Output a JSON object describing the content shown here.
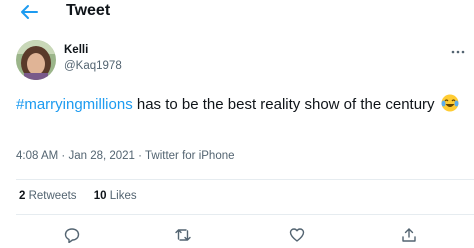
{
  "header": {
    "title": "Tweet"
  },
  "author": {
    "name": "Kelli",
    "handle": "@Kaq1978"
  },
  "tweet": {
    "hashtag": "#marryingmillions",
    "text": " has to be the best reality show of the century",
    "emoji": "face-with-tears-of-joy"
  },
  "meta": {
    "time": "4:08 AM",
    "separator": "·",
    "date": "Jan 28, 2021",
    "source": "Twitter for iPhone"
  },
  "stats": {
    "retweets_count": "2",
    "retweets_label": "Retweets",
    "likes_count": "10",
    "likes_label": "Likes"
  },
  "colors": {
    "accent": "#1d9bf0",
    "secondary_text": "#536471",
    "border": "#e6ecf0"
  },
  "icons": [
    "back-arrow-icon",
    "more-icon",
    "reply-icon",
    "retweet-icon",
    "like-icon",
    "share-icon"
  ]
}
